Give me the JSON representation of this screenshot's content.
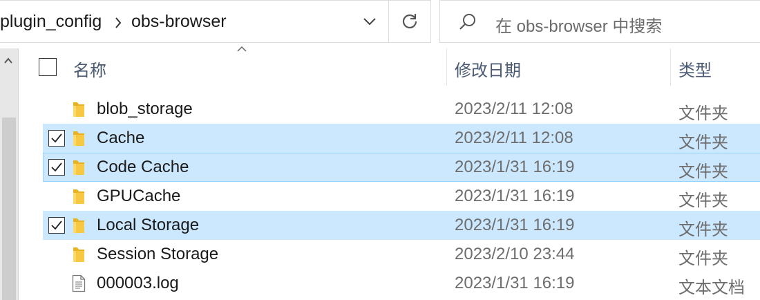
{
  "address_bar": {
    "crumbs": [
      "plugin_config",
      "obs-browser"
    ]
  },
  "search": {
    "placeholder": "在 obs-browser 中搜索"
  },
  "columns": {
    "name": "名称",
    "date": "修改日期",
    "type": "类型"
  },
  "files": [
    {
      "name": "blob_storage",
      "date": "2023/2/11 12:08",
      "type": "文件夹",
      "icon": "folder-icon",
      "selected": false
    },
    {
      "name": "Cache",
      "date": "2023/2/11 12:08",
      "type": "文件夹",
      "icon": "folder-icon",
      "selected": true
    },
    {
      "name": "Code Cache",
      "date": "2023/1/31 16:19",
      "type": "文件夹",
      "icon": "folder-icon",
      "selected": true
    },
    {
      "name": "GPUCache",
      "date": "2023/1/31 16:19",
      "type": "文件夹",
      "icon": "folder-icon",
      "selected": false
    },
    {
      "name": "Local Storage",
      "date": "2023/1/31 16:19",
      "type": "文件夹",
      "icon": "folder-icon",
      "selected": true
    },
    {
      "name": "Session Storage",
      "date": "2023/2/10 23:44",
      "type": "文件夹",
      "icon": "folder-icon",
      "selected": false
    },
    {
      "name": "000003.log",
      "date": "2023/1/31 16:19",
      "type": "文本文档",
      "icon": "text-file-icon",
      "selected": false
    }
  ],
  "colors": {
    "selection": "#cce8ff",
    "selection_border": "#99d1ff",
    "folder": "#f7c843"
  }
}
